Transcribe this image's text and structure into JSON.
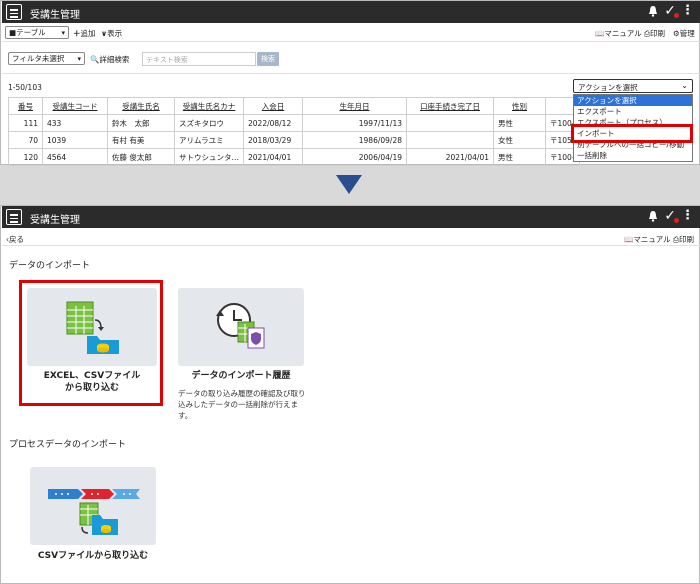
{
  "app": {
    "title": "受講生管理"
  },
  "top": {
    "view_select": "■テーブル",
    "add_label": "追加",
    "show_label": "表示",
    "manual_label": "マニュアル",
    "print_label": "印刷",
    "admin_label": "管理",
    "filter_select": "フィルタ未選択",
    "adv_search_label": "詳細検索",
    "search_placeholder": "テキスト検索",
    "search_button": "検索",
    "record_count": "1-50/103",
    "action_select": "アクションを選択",
    "action_options": [
      "アクションを選択",
      "エクスポート",
      "エクスポート（プロセス）",
      "インポート",
      "別テーブルへの一括コピー/移動",
      "一括削除"
    ],
    "columns": [
      "番号",
      "受講生コード",
      "受講生氏名",
      "受講生氏名カナ",
      "入会日",
      "生年月日",
      "口座手続き完了日",
      "性別",
      ""
    ],
    "rows": [
      [
        "111",
        "433",
        "鈴木　太郎",
        "スズキタロウ",
        "2022/08/12",
        "1997/11/13",
        "",
        "男性",
        "〒100-"
      ],
      [
        "70",
        "1039",
        "有村 有美",
        "アリムラユミ",
        "2018/03/29",
        "1986/09/28",
        "",
        "女性",
        "〒105-"
      ],
      [
        "120",
        "4564",
        "佐藤 俊太郎",
        "サトウシュンタ…",
        "2021/04/01",
        "2006/04/19",
        "2021/04/01",
        "男性",
        "〒100-"
      ]
    ]
  },
  "bottom": {
    "back_label": "戻る",
    "manual_label": "マニュアル",
    "print_label": "印刷",
    "section_import": "データのインポート",
    "card_excel_title_1": "EXCEL、CSVファイル",
    "card_excel_title_2": "から取り込む",
    "card_history_title": "データのインポート履歴",
    "card_history_desc_1": "データの取り込み履歴の確認及び取り",
    "card_history_desc_2": "込みしたデータの一括削除が行えま",
    "card_history_desc_3": "す。",
    "section_process": "プロセスデータのインポート",
    "card_csv_title": "CSVファイルから取り込む"
  },
  "colors": {
    "appbar": "#2b2b2b",
    "highlight": "#e00000",
    "selected": "#2d72d9",
    "arrow": "#2a4d8f",
    "card": "#e4e7eb"
  },
  "icons": [
    "hamburger-icon",
    "bell-icon",
    "check-icon",
    "kebab-icon",
    "plus-icon",
    "chevron-down-icon",
    "book-icon",
    "print-icon",
    "gear-icon",
    "search-icon",
    "back-icon",
    "spreadsheet-import-icon",
    "history-icon",
    "csv-process-import-icon"
  ]
}
